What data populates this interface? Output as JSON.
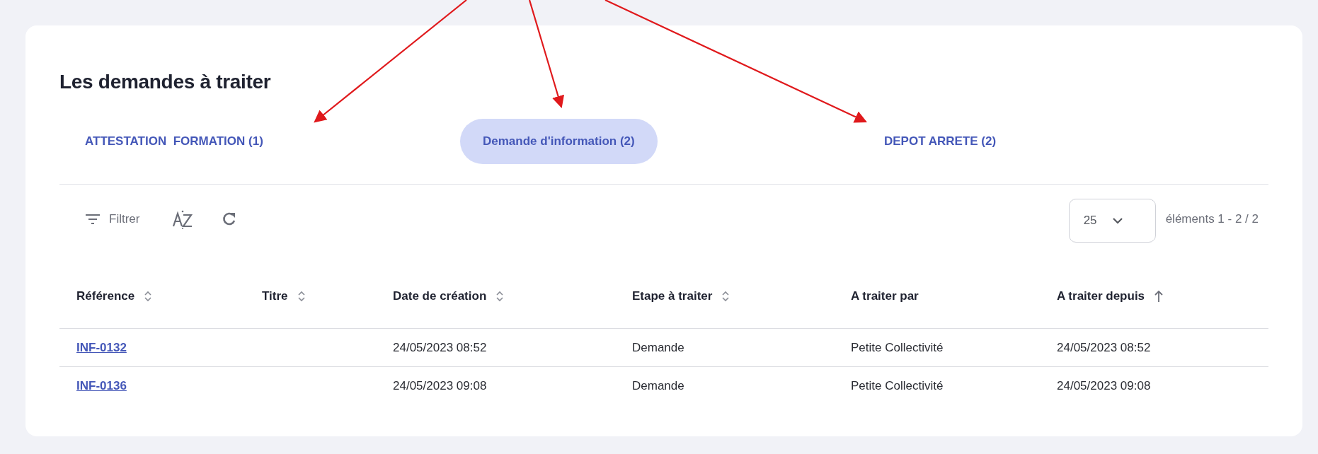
{
  "title": "Les demandes à traiter",
  "tabs": [
    {
      "label": "ATTESTATION  FORMATION (1)",
      "selected": false
    },
    {
      "label": "Demande d'information (2)",
      "selected": true
    },
    {
      "label": "DEPOT ARRETE (2)",
      "selected": false
    }
  ],
  "toolbar": {
    "filter_label": "Filtrer",
    "page_size": "25",
    "range": "éléments 1 - 2 / 2"
  },
  "table": {
    "columns": [
      {
        "label": "Référence",
        "sortable": true,
        "sorted": false
      },
      {
        "label": "Titre",
        "sortable": true,
        "sorted": false
      },
      {
        "label": "Date de création",
        "sortable": true,
        "sorted": false
      },
      {
        "label": "Etape à traiter",
        "sortable": true,
        "sorted": false
      },
      {
        "label": "A traiter par",
        "sortable": false,
        "sorted": false
      },
      {
        "label": "A traiter depuis",
        "sorted": true
      }
    ],
    "rows": [
      {
        "cells": [
          "INF-0132",
          "",
          "24/05/2023 08:52",
          "Demande",
          "Petite Collectivité",
          "24/05/2023 08:52"
        ]
      },
      {
        "cells": [
          "INF-0136",
          "",
          "24/05/2023 09:08",
          "Demande",
          "Petite Collectivité",
          "24/05/2023 09:08"
        ]
      }
    ]
  },
  "annotations": [
    {
      "kind": "arrow"
    },
    {
      "kind": "arrow"
    },
    {
      "kind": "arrow"
    }
  ]
}
